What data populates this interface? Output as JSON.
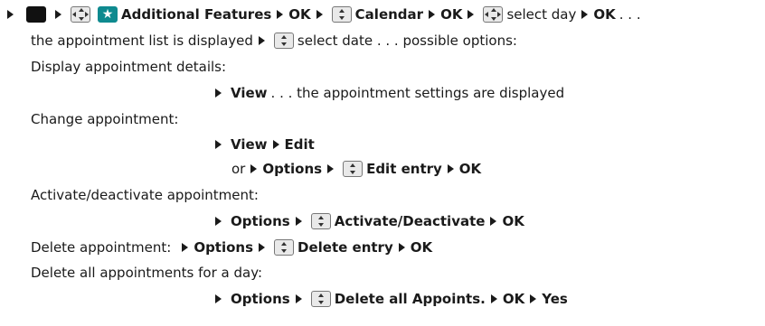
{
  "line1": {
    "menu_label": "Additional Features",
    "ok_1": "OK",
    "calendar_label": "Calendar",
    "ok_2": "OK",
    "select_day": "select day",
    "ok_3": "OK",
    "ellipsis": ". . ."
  },
  "line2": {
    "prefix": "the appointment list is displayed",
    "select_date": "select date . . . possible options:"
  },
  "display_details": {
    "heading": "Display appointment details:",
    "view": "View",
    "view_suffix": ". . . the appointment settings are displayed"
  },
  "change_appt": {
    "heading": "Change appointment:",
    "view": "View",
    "edit": "Edit",
    "or": "or",
    "options": "Options",
    "edit_entry": "Edit entry",
    "ok": "OK"
  },
  "activate": {
    "heading": "Activate/deactivate appointment:",
    "options": "Options",
    "activate_label": "Activate/Deactivate",
    "ok": "OK"
  },
  "delete_appt": {
    "heading": "Delete appointment:",
    "options": "Options",
    "delete_entry": "Delete entry",
    "ok": "OK"
  },
  "delete_all": {
    "heading": "Delete all appointments for a day:",
    "options": "Options",
    "delete_all_label": "Delete all Appoints.",
    "ok": "OK",
    "yes": "Yes"
  },
  "icons": {
    "black_key": "black-menu-key-icon",
    "nav_key": "navigation-key-icon",
    "updown_key": "up-down-key-icon",
    "star_key": "star-icon",
    "arrow": "triangle-arrow-icon"
  },
  "colors": {
    "star_key": "#0e8a8f",
    "text": "#1a1a1a"
  }
}
